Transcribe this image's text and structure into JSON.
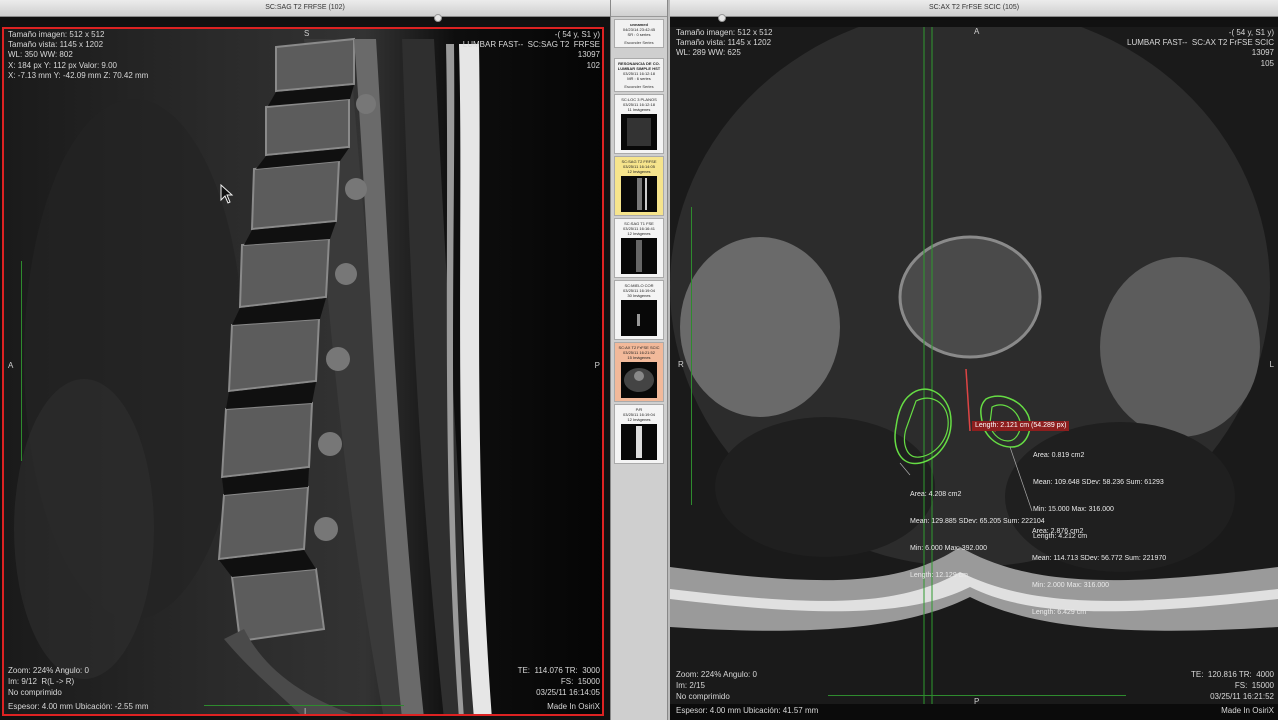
{
  "left_viewer": {
    "title": "SC:SAG T2  FRFSE (102)",
    "overlay_top_left": [
      "Tamaño imagen: 512 x 512",
      "Tamaño vista: 1145 x 1202",
      "WL: 350 WW: 802",
      "X: 184 px Y: 112 px Valor: 9.00",
      "X: -7.13 mm Y: -42.09 mm Z: 70.42 mm"
    ],
    "overlay_top_right": [
      "-( 54 y, S1 y)",
      "LUMBAR FAST--  SC:SAG T2  FRFSE",
      "13097",
      "102"
    ],
    "overlay_bottom_left": [
      "Zoom: 224% Angulo: 0",
      "Im: 9/12  R(L -> R)",
      "No comprimido",
      "Espesor: 4.00 mm Ubicación: -2.55 mm"
    ],
    "overlay_bottom_right": [
      "TE:  114.076 TR:  3000",
      "FS:  15000",
      "03/25/11 16:14:05",
      "Made In OsiriX"
    ],
    "markers": {
      "top": "S",
      "left": "A",
      "right": "P",
      "bottom": "I"
    }
  },
  "right_viewer": {
    "title": "SC:AX T2 FrFSE SCIC (105)",
    "overlay_top_left": [
      "Tamaño imagen: 512 x 512",
      "Tamaño vista: 1145 x 1202",
      "WL: 289 WW: 625"
    ],
    "overlay_top_right": [
      "-( 54 y, S1 y)",
      "LUMBAR FAST--  SC:AX T2 FrFSE SCIC",
      "13097",
      "105"
    ],
    "overlay_bottom_left": [
      "Zoom: 224% Angulo: 0",
      "Im: 2/15",
      "No comprimido",
      "Espesor: 4.00 mm Ubicación: 41.57 mm"
    ],
    "overlay_bottom_right": [
      "TE:  120.816 TR:  4000",
      "FS:  15000",
      "03/25/11 16:21:52",
      "Made In OsiriX"
    ],
    "markers": {
      "top": "A",
      "left": "R",
      "right": "L",
      "bottom": "P"
    },
    "length_label": "Length: 2.121 cm (54.289 px)",
    "roi_1": [
      "Area: 0.819 cm2",
      "Mean: 109.648 SDev: 58.236 Sum: 61293",
      "Min: 15.000 Max: 316.000",
      "Length: 4.212 cm"
    ],
    "roi_2": [
      "Area: 4.208 cm2",
      "Mean: 129.885 SDev: 65.205 Sum: 222104",
      "Min: 6.000 Max: 392.000",
      "Length: 12.129 cm"
    ],
    "roi_3": [
      "Area: 2.876 cm2",
      "Mean: 114.713 SDev: 56.772 Sum: 221970",
      "Min: 2.000 Max: 316.000",
      "Length: 6.429 cm"
    ]
  },
  "series_panel": {
    "studies": [
      {
        "name": "unnamed",
        "date": "04/23/14 23:42:45",
        "count": "SR : 0 series",
        "expand": "Esconder Series"
      },
      {
        "name": "RESONANCIA DE CO. LUMBAR SIMPLE HST",
        "date": "03/25/11 16:12:18",
        "count": "MR : 6 series",
        "expand": "Esconder Series"
      }
    ],
    "series": [
      {
        "name": "SC:LOC 3 PLANOS",
        "date": "03/25/11 16:12:18",
        "count": "11 Imágenes",
        "state": "normal"
      },
      {
        "name": "SC:SAG T2  FRFSE",
        "date": "03/25/11 16:14:05",
        "count": "12 Imágenes",
        "state": "selected"
      },
      {
        "name": "SC:SAG T1 FSE",
        "date": "03/25/11 16:16:41",
        "count": "12 Imágenes",
        "state": "normal"
      },
      {
        "name": "SC:MIELO COR",
        "date": "03/25/11 16:19:04",
        "count": "30 Imágenes",
        "state": "normal"
      },
      {
        "name": "SC:AX T2 FrFSE SCIC",
        "date": "03/25/11 16:21:52",
        "count": "15 Imágenes",
        "state": "active"
      },
      {
        "name": "P/R",
        "date": "03/25/11 16:19:04",
        "count": "12 Imágenes",
        "state": "normal"
      }
    ]
  },
  "colors": {
    "active_border": "#dd2222",
    "roi": "#66dd44",
    "selected_series": "#f6e48c",
    "active_series": "#f2b99a",
    "length_bg": "#8d1e1e"
  }
}
